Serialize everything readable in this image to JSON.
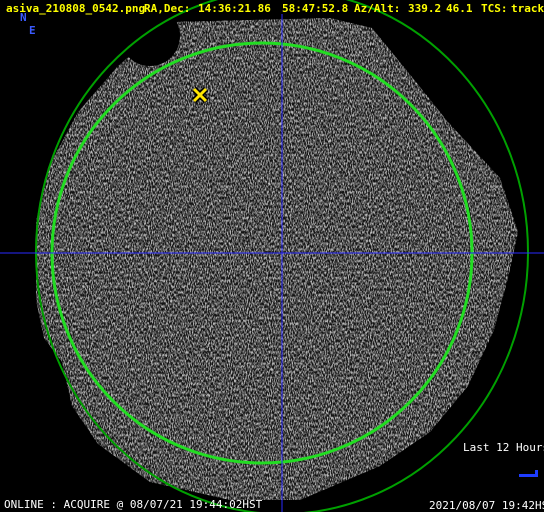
{
  "header": {
    "filename": "asiva_210808_0542.png",
    "radec_label": "RA,Dec:",
    "ra": "14:36:21.86",
    "dec": "58:47:52.8",
    "azalt_label": "Az/Alt:",
    "az": "339.2",
    "alt": "46.1",
    "tcs_label": "TCS:",
    "tcs_mode": "track"
  },
  "compass": {
    "north": "N",
    "east": "E"
  },
  "overlay": {
    "history_label": "Last 12 Hours"
  },
  "footer": {
    "status": "ONLINE : ACQUIRE @ 08/07/21 19:44:02HST",
    "timestamp": "2021/08/07 19:42HST"
  },
  "colors": {
    "header_text": "#ffff00",
    "compass": "#3b5bff",
    "outer_circle": "#00a000",
    "altitude_circle": "#22dd22",
    "crosshair": "#2a2aff",
    "target_marker": "#ffe600",
    "footer_text": "#ffffff"
  },
  "icons": {
    "target": "target-x-icon"
  }
}
